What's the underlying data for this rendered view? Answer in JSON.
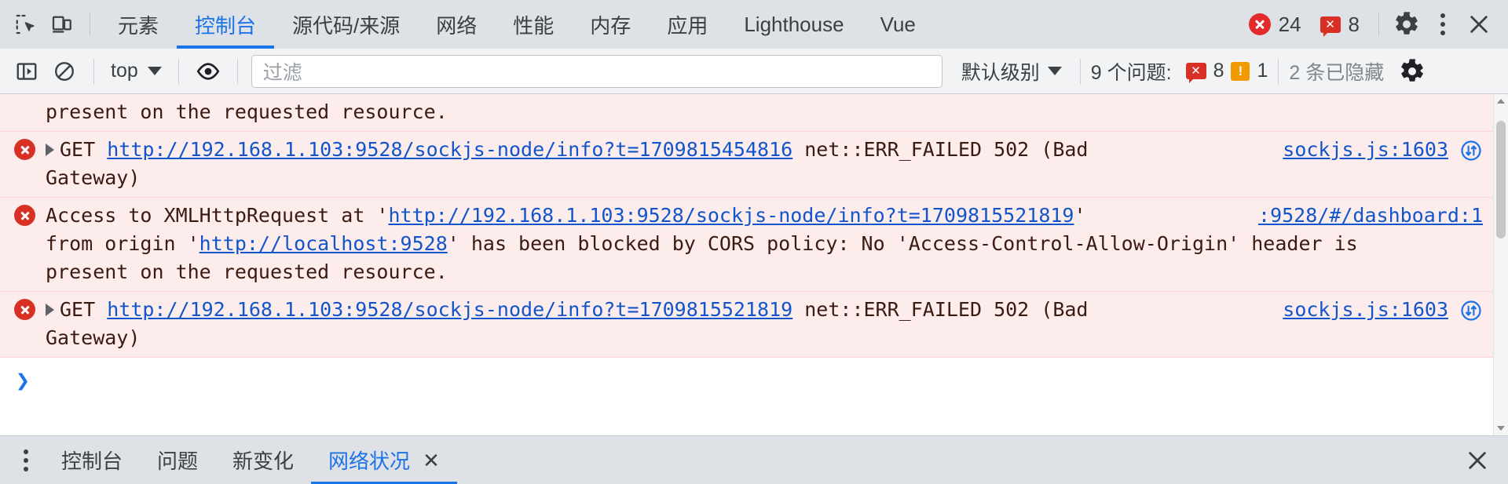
{
  "panel_tabbar": {
    "icons": [
      {
        "name": "inspect-element-icon",
        "label": "检查元素"
      },
      {
        "name": "device-toolbar-icon",
        "label": "设备工具栏"
      }
    ],
    "tabs": [
      {
        "label": "元素",
        "selected": false
      },
      {
        "label": "控制台",
        "selected": true
      },
      {
        "label": "源代码/来源",
        "selected": false
      },
      {
        "label": "网络",
        "selected": false
      },
      {
        "label": "性能",
        "selected": false
      },
      {
        "label": "内存",
        "selected": false
      },
      {
        "label": "应用",
        "selected": false
      },
      {
        "label": "Lighthouse",
        "selected": false
      },
      {
        "label": "Vue",
        "selected": false
      }
    ],
    "error_count": "24",
    "issue_count": "8",
    "settings_label": "设置",
    "more_label": "更多选项",
    "close_label": "关闭"
  },
  "console_toolbar": {
    "sidebar_toggle_label": "控制台边栏",
    "clear_label": "清除控制台",
    "context": "top",
    "eye_label": "实时表达式",
    "filter_placeholder": "过滤",
    "filter_value": "",
    "level": "默认级别",
    "issues_label": "9 个问题:",
    "issue_error_count": "8",
    "issue_warning_count": "1",
    "hidden_label": "2 条已隐藏",
    "settings_label": "控制台设置"
  },
  "console_messages": [
    {
      "id": "msg-0-continuation",
      "kind": "error-continuation",
      "has_icon": false,
      "has_disclosure": false,
      "lines": [
        [
          {
            "t": "present on the requested resource.",
            "link": false
          }
        ]
      ],
      "source": "",
      "has_net_icon": false
    },
    {
      "id": "msg-1",
      "kind": "error",
      "has_icon": true,
      "has_disclosure": true,
      "lines": [
        [
          {
            "t": "GET ",
            "link": false
          },
          {
            "t": "http://192.168.1.103:9528/sockjs-node/info?t=1709815454816",
            "link": true
          },
          {
            "t": " net::ERR_FAILED 502 (Bad",
            "link": false
          }
        ],
        [
          {
            "t": "Gateway)",
            "link": false
          }
        ]
      ],
      "source": "sockjs.js:1603",
      "has_net_icon": true
    },
    {
      "id": "msg-2",
      "kind": "error",
      "has_icon": true,
      "has_disclosure": false,
      "lines": [
        [
          {
            "t": "Access to XMLHttpRequest at '",
            "link": false
          },
          {
            "t": "http://192.168.1.103:9528/sockjs-node/info?t=1709815521819",
            "link": true
          },
          {
            "t": "'",
            "link": false
          }
        ],
        [
          {
            "t": "from origin '",
            "link": false
          },
          {
            "t": "http://localhost:9528",
            "link": true
          },
          {
            "t": "' has been blocked by CORS policy: No 'Access-Control-Allow-Origin' header is",
            "link": false
          }
        ],
        [
          {
            "t": "present on the requested resource.",
            "link": false
          }
        ]
      ],
      "source": ":9528/#/dashboard:1",
      "has_net_icon": false
    },
    {
      "id": "msg-3",
      "kind": "error",
      "has_icon": true,
      "has_disclosure": true,
      "lines": [
        [
          {
            "t": "GET ",
            "link": false
          },
          {
            "t": "http://192.168.1.103:9528/sockjs-node/info?t=1709815521819",
            "link": true
          },
          {
            "t": " net::ERR_FAILED 502 (Bad",
            "link": false
          }
        ],
        [
          {
            "t": "Gateway)",
            "link": false
          }
        ]
      ],
      "source": "sockjs.js:1603",
      "has_net_icon": true
    }
  ],
  "prompt": {
    "caret": "❯",
    "value": ""
  },
  "drawer": {
    "more_label": "更多工具",
    "tabs": [
      {
        "label": "控制台",
        "selected": false,
        "closable": false
      },
      {
        "label": "问题",
        "selected": false,
        "closable": false
      },
      {
        "label": "新变化",
        "selected": false,
        "closable": false
      },
      {
        "label": "网络状况",
        "selected": true,
        "closable": true
      }
    ],
    "close_symbol": "✕",
    "close_drawer_label": "关闭抽屉"
  },
  "colors": {
    "accent": "#1a73e8",
    "error_bg": "#fcecec",
    "error_red": "#d93025",
    "warning_orange": "#f29900",
    "link": "#1155cc",
    "toolbar_bg": "#dee1e6",
    "subtoolbar_bg": "#f1f3f4"
  }
}
